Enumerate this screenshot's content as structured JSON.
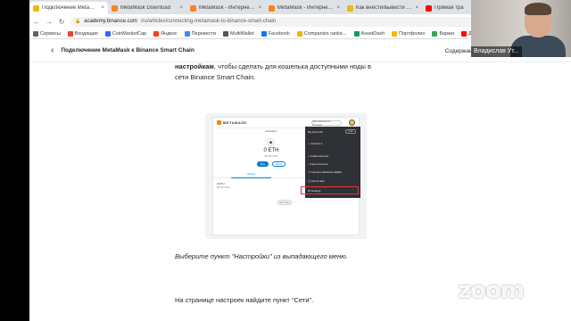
{
  "browser": {
    "tabs": [
      {
        "label": "Подключение MetaMask к",
        "color": "#f0b90b",
        "active": true
      },
      {
        "label": "MetaMask Download",
        "color": "#f6851b",
        "active": false
      },
      {
        "label": "MetaMask - Интернет-ма",
        "color": "#f6851b",
        "active": false
      },
      {
        "label": "MetaMask - Интернет-ма",
        "color": "#f6851b",
        "active": false
      },
      {
        "label": "Как внести/вывести крип",
        "color": "#f0b90b",
        "active": false
      },
      {
        "label": "Прямая тра",
        "color": "#ff0000",
        "active": false
      }
    ],
    "tab_close_glyph": "×",
    "url_host": "academy.binance.com",
    "url_path": "/ru/articles/connecting-metamask-to-binance-smart-chain",
    "bookmarks": [
      {
        "label": "Сервисы",
        "color": "#5f6368"
      },
      {
        "label": "Входящие",
        "color": "#ea4335"
      },
      {
        "label": "CoinMarketCap",
        "color": "#3861fb"
      },
      {
        "label": "Яндекс",
        "color": "#fc3f1d"
      },
      {
        "label": "Перевести",
        "color": "#4285f4"
      },
      {
        "label": "MultiWallet",
        "color": "#555555"
      },
      {
        "label": "Facebook",
        "color": "#1877f2"
      },
      {
        "label": "Companies ranke...",
        "color": "#f4b400"
      },
      {
        "label": "AssetDash",
        "color": "#0f9d58"
      },
      {
        "label": "Портфолио",
        "color": "#f0b90b"
      },
      {
        "label": "Биржи",
        "color": "#34a853"
      },
      {
        "label": "Девай в н",
        "color": "#ff0000"
      }
    ]
  },
  "page": {
    "back_glyph": "‹",
    "subhead_title": "Подключение MetaMask к Binance Smart Chain",
    "toc_label": "Содержание",
    "toc_glyph": "⌄",
    "intro_bold": "настройкам",
    "intro_rest_line1": ", чтобы сделать для кошелька доступными ноды в",
    "intro_line2": "сети Binance Smart Chain.",
    "caption": "Выберите пункт \"Настройки\" из выпадающего меню.",
    "para2": "На странице настроек найдите пункт \"Сети\"."
  },
  "metamask": {
    "logo": "METAMASK",
    "network": "Main Ethereum Network",
    "account": "Account 1",
    "eth_symbol": "◆",
    "balance": "0 ETH",
    "usd": "$0.00 USD",
    "buy": "Buy",
    "send": "Send",
    "assets_tab": "Assets",
    "token_row": "0 ETH",
    "token_row_usd": "$0.00 USD",
    "add_token": "Add Token",
    "menu": {
      "header": "My Accounts",
      "lock": "Lock",
      "items": [
        "Account 1",
        "Create Account",
        "Import Account",
        "Connect Hardware Wallet",
        "Info & Help",
        "Settings"
      ]
    }
  },
  "webcam": {
    "name": "Владислав Ут..."
  },
  "watermark": "zoom"
}
